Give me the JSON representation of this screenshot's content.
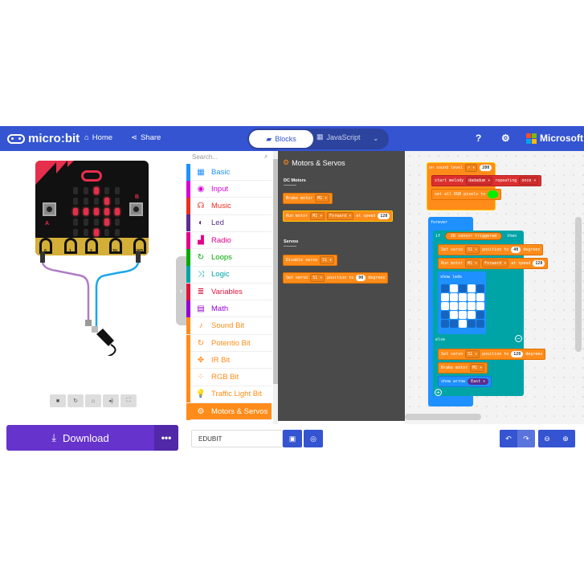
{
  "header": {
    "app_name": "micro:bit",
    "home_label": "Home",
    "share_label": "Share",
    "blocks_label": "Blocks",
    "javascript_label": "JavaScript",
    "brand": "Microsoft",
    "colors": {
      "header": "#3454d1",
      "download": "#6633cc",
      "motors": "#ff8c1a"
    }
  },
  "simulator": {
    "led_matrix": [
      [
        0,
        0,
        1,
        0,
        0
      ],
      [
        0,
        0,
        0,
        1,
        0
      ],
      [
        1,
        1,
        1,
        1,
        1
      ],
      [
        0,
        0,
        0,
        1,
        0
      ],
      [
        0,
        0,
        1,
        0,
        0
      ]
    ],
    "button_a": "A",
    "button_b": "B",
    "pins": [
      "0",
      "1",
      "2",
      "3V",
      "GND"
    ],
    "controls": [
      "stop-icon",
      "restart-icon",
      "debug-icon",
      "mute-icon",
      "fullscreen-icon"
    ]
  },
  "download": {
    "label": "Download",
    "more_label": "•••"
  },
  "toolbox": {
    "search_placeholder": "Search...",
    "categories": [
      {
        "label": "Basic",
        "color": "#1e90ff",
        "icon": "▦"
      },
      {
        "label": "Input",
        "color": "#d400d4",
        "icon": "◉"
      },
      {
        "label": "Music",
        "color": "#e63022",
        "icon": "☊"
      },
      {
        "label": "Led",
        "color": "#5c2d91",
        "icon": "◐"
      },
      {
        "label": "Radio",
        "color": "#e3008c",
        "icon": "▟"
      },
      {
        "label": "Loops",
        "color": "#00aa00",
        "icon": "↻"
      },
      {
        "label": "Logic",
        "color": "#00a4a6",
        "icon": "⤨"
      },
      {
        "label": "Variables",
        "color": "#dc143c",
        "icon": "≣"
      },
      {
        "label": "Math",
        "color": "#9400d3",
        "icon": "▤"
      },
      {
        "label": "Sound Bit",
        "color": "#ff8c1a",
        "icon": "♪"
      },
      {
        "label": "Potentio Bit",
        "color": "#ff8c1a",
        "icon": "↻"
      },
      {
        "label": "IR Bit",
        "color": "#ff8c1a",
        "icon": "✥"
      },
      {
        "label": "RGB Bit",
        "color": "#ff8c1a",
        "icon": "⁘"
      },
      {
        "label": "Traffic Light Bit",
        "color": "#ff8c1a",
        "icon": "💡"
      },
      {
        "label": "Motors & Servos",
        "color": "#ff8c1a",
        "icon": "⚙"
      }
    ],
    "selected": "Motors & Servos"
  },
  "flyout": {
    "title": "Motors & Servos",
    "section_dc": "DC Motors",
    "section_servos": "Servos",
    "brake": {
      "text": "Brake motor",
      "motor": "M1 ▾"
    },
    "run": {
      "text": "Run motor",
      "motor": "M1 ▾",
      "dir": "Forward ▾",
      "speed_label": "at speed",
      "speed": "128"
    },
    "disable": {
      "text": "Disable servo",
      "servo": "S1 ▾"
    },
    "setservo": {
      "text": "Set servo",
      "servo": "S1 ▾",
      "pos_label": "position to",
      "pos": "90",
      "deg": "degrees"
    }
  },
  "workspace": {
    "event": {
      "text": "on sound level",
      "op": "> ▾",
      "value": "200"
    },
    "melody": {
      "text": "start melody",
      "melody": "dadadum ▾",
      "repeat_label": "repeating",
      "repeat": "once ▾"
    },
    "rgb": {
      "text": "set all RGB pixels to",
      "color": "#00ee00"
    },
    "forever": "forever",
    "if_label": "if",
    "condition": "IR sensor triggered",
    "then_label": "then",
    "servo1": {
      "text": "Set servo",
      "servo": "S1 ▾",
      "pos_label": "position to",
      "pos": "40",
      "deg": "degrees"
    },
    "run": {
      "text": "Run motor",
      "motor": "M1 ▾",
      "dir": "Forward ▾",
      "speed_label": "at speed",
      "speed": "128"
    },
    "show_leds": "show leds",
    "leds": [
      [
        0,
        1,
        0,
        1,
        0
      ],
      [
        1,
        1,
        1,
        1,
        1
      ],
      [
        1,
        1,
        1,
        1,
        1
      ],
      [
        0,
        1,
        1,
        1,
        0
      ],
      [
        0,
        0,
        1,
        0,
        0
      ]
    ],
    "else_label": "else",
    "servo2": {
      "text": "Set servo",
      "servo": "S1 ▾",
      "pos_label": "position to",
      "pos": "120",
      "deg": "degrees"
    },
    "brake": {
      "text": "Brake motor",
      "motor": "M1 ▾"
    },
    "arrow": {
      "text": "show arrow",
      "dir": "East ▾"
    }
  },
  "footer": {
    "project_name": "EDUBIT"
  }
}
